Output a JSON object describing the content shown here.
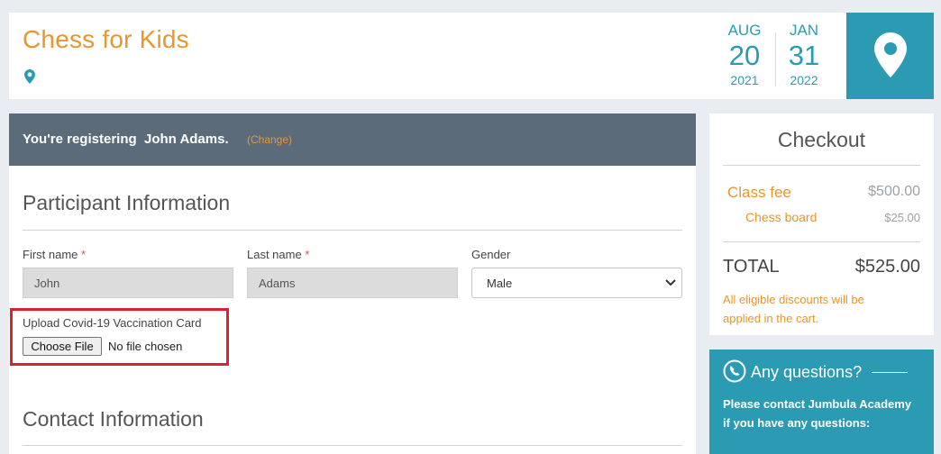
{
  "header": {
    "title": "Chess for Kids",
    "dates": {
      "start": {
        "month": "AUG",
        "day": "20",
        "year": "2021"
      },
      "end": {
        "month": "JAN",
        "day": "31",
        "year": "2022"
      }
    }
  },
  "registration": {
    "prefix": "You're registering",
    "name": "John Adams.",
    "change_label": "(Change)"
  },
  "participant": {
    "section_title": "Participant Information",
    "first_name_label": "First name",
    "first_name_value": "John",
    "last_name_label": "Last name",
    "last_name_value": "Adams",
    "gender_label": "Gender",
    "gender_value": "Male",
    "required_mark": "*",
    "upload_label": "Upload Covid-19 Vaccination Card",
    "choose_file_label": "Choose File",
    "no_file_text": "No file chosen"
  },
  "contact": {
    "section_title": "Contact Information"
  },
  "checkout": {
    "title": "Checkout",
    "items": [
      {
        "label": "Class fee",
        "amount": "$500.00"
      },
      {
        "label": "Chess board",
        "amount": "$25.00"
      }
    ],
    "total_label": "TOTAL",
    "total_amount": "$525.00",
    "discount_note": "All eligible discounts will be applied in the cart."
  },
  "questions": {
    "title": "Any questions?",
    "text": "Please contact Jumbula Academy if you have any questions:"
  },
  "colors": {
    "accent_orange": "#e8962e",
    "accent_teal": "#2a9bb3",
    "bar_gray": "#5b6b79",
    "highlight_red": "#d9232d"
  }
}
